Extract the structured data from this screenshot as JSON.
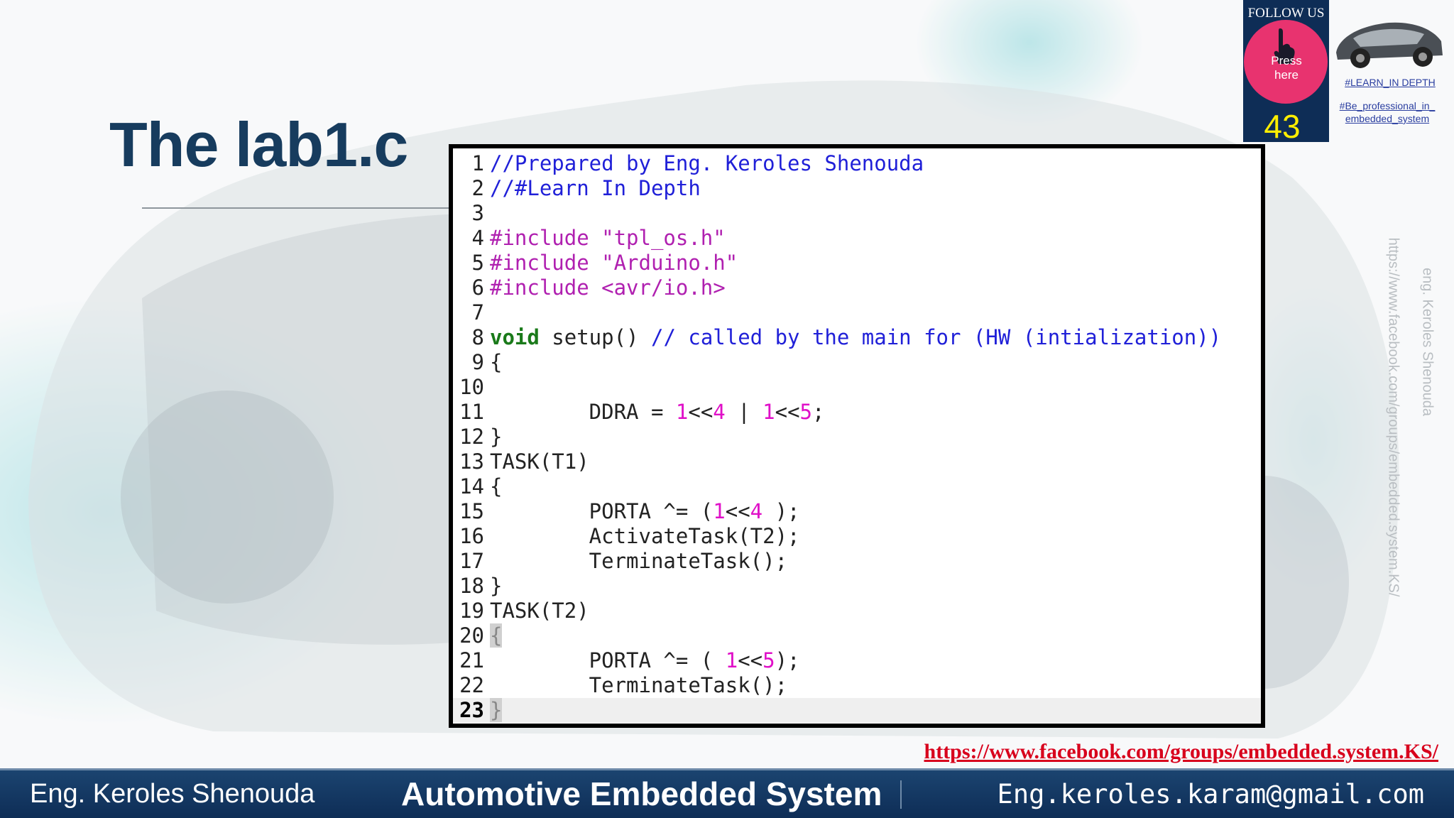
{
  "slide": {
    "title": "The lab1.c",
    "accent_color": "#173c5e"
  },
  "code": {
    "lines": [
      {
        "n": "1",
        "html": "<span class=\"t-cm\">//Prepared by Eng. Keroles Shenouda</span>"
      },
      {
        "n": "2",
        "html": "<span class=\"t-cm\">//#Learn In Depth</span>"
      },
      {
        "n": "3",
        "html": ""
      },
      {
        "n": "4",
        "html": "<span class=\"t-pp\">#include \"tpl_os.h\"</span>"
      },
      {
        "n": "5",
        "html": "<span class=\"t-pp\">#include \"Arduino.h\"</span>"
      },
      {
        "n": "6",
        "html": "<span class=\"t-pp\">#include &lt;avr/io.h&gt;</span>"
      },
      {
        "n": "7",
        "html": ""
      },
      {
        "n": "8",
        "html": "<span class=\"t-kw\">void</span> setup() <span class=\"t-cm\">// called by the main for (HW (intialization))</span>"
      },
      {
        "n": "9",
        "html": "{"
      },
      {
        "n": "10",
        "html": ""
      },
      {
        "n": "11",
        "html": "        DDRA = <span class=\"t-num\">1</span>&lt;&lt;<span class=\"t-num\">4</span> | <span class=\"t-num\">1</span>&lt;&lt;<span class=\"t-num\">5</span>;"
      },
      {
        "n": "12",
        "html": "}"
      },
      {
        "n": "13",
        "html": "TASK(T1)"
      },
      {
        "n": "14",
        "html": "{"
      },
      {
        "n": "15",
        "html": "        PORTA ^= (<span class=\"t-num\">1</span>&lt;&lt;<span class=\"t-num\">4</span> );"
      },
      {
        "n": "16",
        "html": "        ActivateTask(T2);"
      },
      {
        "n": "17",
        "html": "        TerminateTask();"
      },
      {
        "n": "18",
        "html": "}"
      },
      {
        "n": "19",
        "html": "TASK(T2)"
      },
      {
        "n": "20",
        "html": "<span class=\"t-br\">{</span>"
      },
      {
        "n": "21",
        "html": "        PORTA ^= ( <span class=\"t-num\">1</span>&lt;&lt;<span class=\"t-num\">5</span>);"
      },
      {
        "n": "22",
        "html": "        TerminateTask();"
      },
      {
        "n": "23",
        "html": "<span class=\"t-br\">}</span>"
      }
    ],
    "current_line": "23"
  },
  "badge": {
    "follow_label": "FOLLOW US",
    "press_label_1": "Press",
    "press_label_2": "here",
    "page_number": "43",
    "hand_icon": "pointing-hand-icon",
    "circle_color": "#e8336f"
  },
  "tags": {
    "learn": "#LEARN_IN DEPTH",
    "professional_1": "#Be_professional_in_",
    "professional_2": "embedded_system"
  },
  "watermark": {
    "name": "eng. Keroles Shenouda",
    "url": "https://www.facebook.com/groups/embedded.system.KS/"
  },
  "footer": {
    "link": "https://www.facebook.com/groups/embedded.system.KS/",
    "author": "Eng. Keroles Shenouda",
    "course": "Automotive Embedded System",
    "email": "Eng.keroles.karam@gmail.com",
    "bar_color": "#0e2d56"
  }
}
